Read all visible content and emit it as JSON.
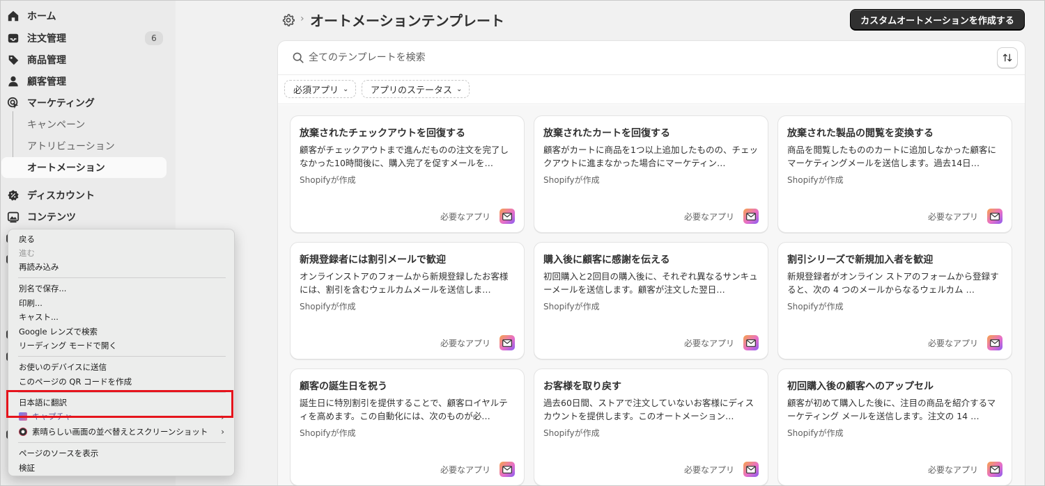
{
  "sidebar": {
    "items": [
      {
        "label": "ホーム",
        "icon": "home-icon"
      },
      {
        "label": "注文管理",
        "icon": "inbox-icon",
        "badge": "6"
      },
      {
        "label": "商品管理",
        "icon": "tag-icon"
      },
      {
        "label": "顧客管理",
        "icon": "person-icon"
      },
      {
        "label": "マーケティング",
        "icon": "target-icon"
      }
    ],
    "marketing_sub": [
      "キャンペーン",
      "アトリビューション",
      "オートメーション"
    ],
    "lower_items": [
      {
        "label": "ディスカウント",
        "icon": "discount-icon"
      },
      {
        "label": "コンテンツ",
        "icon": "image-icon"
      }
    ]
  },
  "header": {
    "title": "オートメーションテンプレート",
    "create_button": "カスタムオートメーションを作成する"
  },
  "search": {
    "placeholder": "全てのテンプレートを検索"
  },
  "filters": [
    "必須アプリ",
    "アプリのステータス"
  ],
  "cards": [
    {
      "title": "放棄されたチェックアウトを回復する",
      "desc": "顧客がチェックアウトまで進んだものの注文を完了しなかった10時間後に、購入完了を促すメールを…",
      "by": "Shopifyが作成",
      "req": "必要なアプリ"
    },
    {
      "title": "放棄されたカートを回復する",
      "desc": "顧客がカートに商品を1つ以上追加したものの、チェックアウトに進まなかった場合にマーケティン…",
      "by": "Shopifyが作成",
      "req": "必要なアプリ"
    },
    {
      "title": "放棄された製品の閲覧を変換する",
      "desc": "商品を閲覧したもののカートに追加しなかった顧客にマーケティングメールを送信します。過去14日…",
      "by": "Shopifyが作成",
      "req": "必要なアプリ"
    },
    {
      "title": "新規登録者には割引メールで歓迎",
      "desc": "オンラインストアのフォームから新規登録したお客様には、割引を含むウェルカムメールを送信しま…",
      "by": "Shopifyが作成",
      "req": "必要なアプリ"
    },
    {
      "title": "購入後に顧客に感謝を伝える",
      "desc": "初回購入と2回目の購入後に、それぞれ異なるサンキューメールを送信します。顧客が注文した翌日…",
      "by": "Shopifyが作成",
      "req": "必要なアプリ"
    },
    {
      "title": "割引シリーズで新規加入者を歓迎",
      "desc": "新規登録者がオンライン ストアのフォームから登録すると、次の 4 つのメールからなるウェルカム …",
      "by": "Shopifyが作成",
      "req": "必要なアプリ"
    },
    {
      "title": "顧客の誕生日を祝う",
      "desc": "誕生日に特別割引を提供することで、顧客ロイヤルティを高めます。この自動化には、次のものが必…",
      "by": "Shopifyが作成",
      "req": "必要なアプリ"
    },
    {
      "title": "お客様を取り戻す",
      "desc": "過去60日間、ストアで注文していないお客様にディスカウントを提供します。このオートメーション…",
      "by": "Shopifyが作成",
      "req": "必要なアプリ"
    },
    {
      "title": "初回購入後の顧客へのアップセル",
      "desc": "顧客が初めて購入した後に、注目の商品を紹介するマーケティング メールを送信します。注文の 14 …",
      "by": "Shopifyが作成",
      "req": "必要なアプリ"
    }
  ],
  "context_menu": {
    "back": "戻る",
    "forward": "進む",
    "reload": "再読み込み",
    "save_as": "別名で保存...",
    "print": "印刷...",
    "cast": "キャスト...",
    "google_lens": "Google レンズで検索",
    "reading_mode": "リーディング モードで開く",
    "send_device": "お使いのデバイスに送信",
    "qr_code": "このページの QR コードを作成",
    "translate": "日本語に翻訳",
    "capture": "キャプチャ",
    "screenshot_ext": "素晴らしい画面の並べ替えとスクリーンショット",
    "view_source": "ページのソースを表示",
    "inspect": "検証"
  }
}
